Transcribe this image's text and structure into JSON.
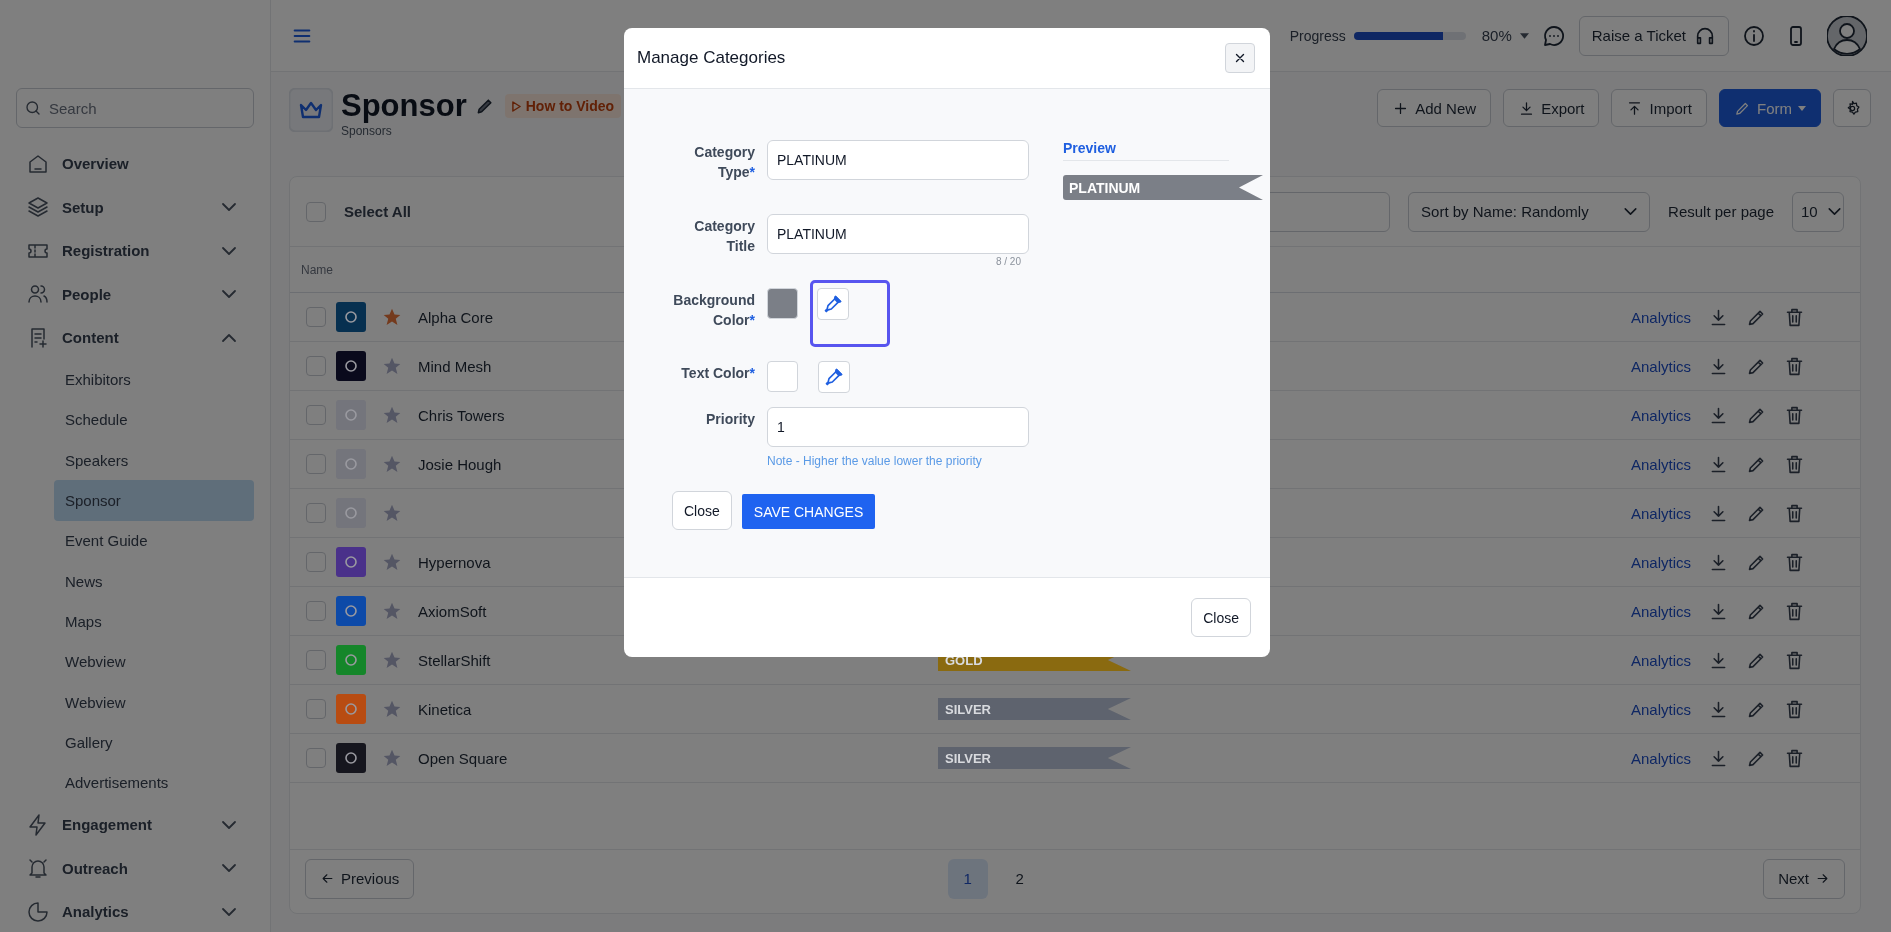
{
  "topbar": {
    "progress": {
      "label": "Progress",
      "level": 0.8,
      "reading": "80%"
    },
    "ticket_button": "Raise a Ticket"
  },
  "sidebar": {
    "search": {
      "placeholder": "Search"
    },
    "items": [
      {
        "label": "Overview",
        "kind": "link"
      },
      {
        "label": "Setup",
        "kind": "group",
        "expanded": false
      },
      {
        "label": "Registration",
        "kind": "group",
        "expanded": false
      },
      {
        "label": "People",
        "kind": "group",
        "expanded": false
      },
      {
        "label": "Content",
        "kind": "group",
        "expanded": true,
        "children": [
          {
            "label": "Exhibitors",
            "selected": false
          },
          {
            "label": "Schedule",
            "selected": false
          },
          {
            "label": "Speakers",
            "selected": false
          },
          {
            "label": "Sponsor",
            "selected": true
          },
          {
            "label": "Event Guide",
            "selected": false
          },
          {
            "label": "News",
            "selected": false
          },
          {
            "label": "Maps",
            "selected": false
          },
          {
            "label": "Webview",
            "selected": false
          },
          {
            "label": "Webview",
            "selected": false
          },
          {
            "label": "Gallery",
            "selected": false
          },
          {
            "label": "Advertisements",
            "selected": false
          }
        ]
      },
      {
        "label": "Engagement",
        "kind": "group",
        "expanded": false
      },
      {
        "label": "Outreach",
        "kind": "group",
        "expanded": false
      },
      {
        "label": "Analytics",
        "kind": "group",
        "expanded": false
      }
    ]
  },
  "header": {
    "title": "Sponsor",
    "subtitle": "Sponsors",
    "video_link": "How to Video",
    "buttons": [
      {
        "label": "Add New",
        "kind": "add"
      },
      {
        "label": "Export",
        "kind": "export"
      },
      {
        "label": "Import",
        "kind": "import"
      },
      {
        "label": "Form",
        "kind": "form"
      }
    ]
  },
  "table": {
    "select_all": {
      "label": "Select All",
      "checked": false
    },
    "sort": "Sort by Name: Randomly",
    "per_page": {
      "label": "Result per page",
      "value": "10"
    },
    "columns": [
      "Name"
    ],
    "rows": [
      {
        "name": "Alpha Core",
        "checked": false,
        "starred": true,
        "color": "#073050",
        "action": "Analytics"
      },
      {
        "name": "Mind Mesh",
        "checked": false,
        "starred": false,
        "color": "#0a0a1c",
        "action": "Analytics"
      },
      {
        "name": "Chris Towers",
        "checked": false,
        "starred": false,
        "color": "#74757c",
        "action": "Analytics"
      },
      {
        "name": "Josie Hough",
        "checked": false,
        "starred": false,
        "color": "#74757c",
        "action": "Analytics"
      },
      {
        "checked": false,
        "starred": false,
        "color": "#74757c",
        "action": "Analytics"
      },
      {
        "name": "Hypernova",
        "checked": false,
        "starred": false,
        "color": "#4a318a",
        "action": "Analytics"
      },
      {
        "name": "AxiomSoft",
        "checked": false,
        "starred": false,
        "color": "#0d4aa8",
        "action": "Analytics"
      },
      {
        "name": "StellarShift",
        "checked": false,
        "starred": false,
        "color": "#15862a",
        "category": {
          "label": "GOLD",
          "color": "#8a6a10"
        },
        "action": "Analytics"
      },
      {
        "name": "Kinetica",
        "checked": false,
        "starred": false,
        "color": "#b84c12",
        "category": {
          "label": "SILVER",
          "color": "#5e636e"
        },
        "action": "Analytics"
      },
      {
        "name": "Open Square",
        "checked": false,
        "starred": false,
        "color": "#16161e",
        "category": {
          "label": "SILVER",
          "color": "#5e636e"
        },
        "action": "Analytics"
      }
    ],
    "pagination": {
      "previous": "Previous",
      "next": "Next",
      "pages": [
        {
          "label": "1",
          "selected": true
        },
        {
          "label": "2",
          "selected": false
        }
      ]
    }
  },
  "modal": {
    "title": "Manage Categories",
    "fields": [
      {
        "kind": "text",
        "label": "Category Type",
        "required": "*",
        "value": "PLATINUM"
      },
      {
        "kind": "text",
        "label": "Category Title",
        "value": "PLATINUM",
        "counter": "8 / 20"
      },
      {
        "kind": "color",
        "label": "Background Color",
        "required": "*",
        "color": "#7b7f87",
        "focused": true
      },
      {
        "kind": "color",
        "label": "Text Color",
        "required": "*",
        "color": "#ffffff",
        "focused": false
      },
      {
        "kind": "text",
        "label": "Priority",
        "value": "1",
        "note": "Note - Higher the value lower the priority"
      }
    ],
    "preview": {
      "label": "Preview",
      "badge": "PLATINUM"
    },
    "close_button": "Close",
    "save_button": "SAVE CHANGES",
    "footer_button": "Close"
  }
}
